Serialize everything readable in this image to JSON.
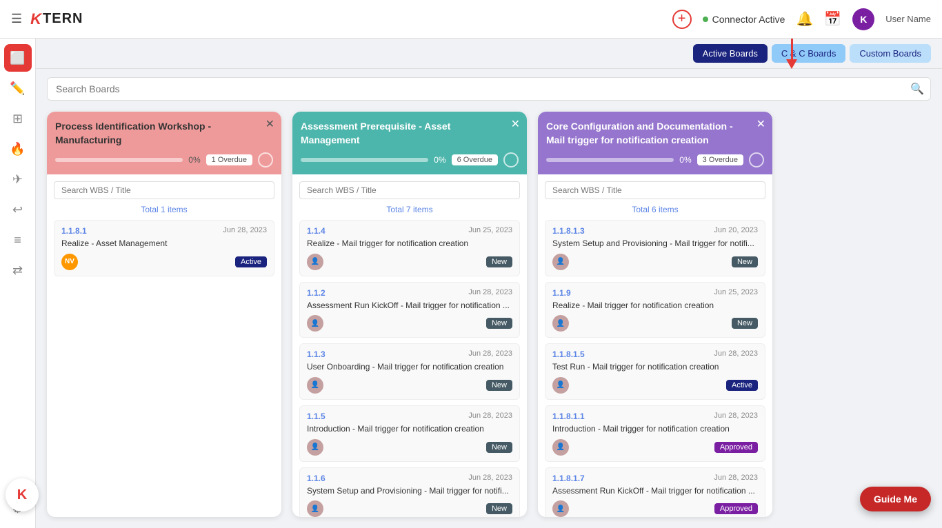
{
  "header": {
    "menu_icon": "☰",
    "logo_k": "K",
    "logo_text": "TERN",
    "connector_label": "Connector Active",
    "add_icon": "+",
    "notification_icon": "🔔",
    "calendar_icon": "📅",
    "avatar_letter": "K",
    "user_name": "User Name"
  },
  "toolbar": {
    "active_boards_label": "Active Boards",
    "cc_boards_label": "C & C Boards",
    "custom_boards_label": "Custom Boards"
  },
  "search": {
    "placeholder": "Search Boards"
  },
  "boards": [
    {
      "id": "board-1",
      "color": "pink",
      "title": "Process Identification Workshop - Manufacturing",
      "progress": 0,
      "progress_label": "0%",
      "overdue": "1 Overdue",
      "total_items": "Total 1 items",
      "search_placeholder": "Search WBS / Title",
      "tasks": [
        {
          "wbs": "1.1.8.1",
          "date": "Jun 28, 2023",
          "title": "Realize - Asset Management",
          "avatar_type": "nv",
          "avatar_text": "NV",
          "status": "Active",
          "status_class": "status-active"
        }
      ]
    },
    {
      "id": "board-2",
      "color": "teal",
      "title": "Assessment Prerequisite - Asset Management",
      "progress": 0,
      "progress_label": "0%",
      "overdue": "6 Overdue",
      "total_items": "Total 7 items",
      "search_placeholder": "Search WBS / Title",
      "tasks": [
        {
          "wbs": "1.1.4",
          "date": "Jun 25, 2023",
          "title": "Realize - Mail trigger for notification creation",
          "avatar_type": "img",
          "status": "New",
          "status_class": "status-new"
        },
        {
          "wbs": "1.1.2",
          "date": "Jun 28, 2023",
          "title": "Assessment Run KickOff - Mail trigger for notification ...",
          "avatar_type": "img",
          "status": "New",
          "status_class": "status-new"
        },
        {
          "wbs": "1.1.3",
          "date": "Jun 28, 2023",
          "title": "User Onboarding - Mail trigger for notification creation",
          "avatar_type": "img",
          "status": "New",
          "status_class": "status-new"
        },
        {
          "wbs": "1.1.5",
          "date": "Jun 28, 2023",
          "title": "Introduction - Mail trigger for notification creation",
          "avatar_type": "img",
          "status": "New",
          "status_class": "status-new"
        },
        {
          "wbs": "1.1.6",
          "date": "Jun 28, 2023",
          "title": "System Setup and Provisioning - Mail trigger for notifi...",
          "avatar_type": "img",
          "status": "New",
          "status_class": "status-new"
        }
      ]
    },
    {
      "id": "board-3",
      "color": "purple",
      "title": "Core Configuration and Documentation - Mail trigger for notification creation",
      "progress": 0,
      "progress_label": "0%",
      "overdue": "3 Overdue",
      "total_items": "Total 6 items",
      "search_placeholder": "Search WBS / Title",
      "tasks": [
        {
          "wbs": "1.1.8.1.3",
          "date": "Jun 20, 2023",
          "title": "System Setup and Provisioning - Mail trigger for notifi...",
          "avatar_type": "img",
          "status": "New",
          "status_class": "status-new"
        },
        {
          "wbs": "1.1.9",
          "date": "Jun 25, 2023",
          "title": "Realize - Mail trigger for notification creation",
          "avatar_type": "img",
          "status": "New",
          "status_class": "status-new"
        },
        {
          "wbs": "1.1.8.1.5",
          "date": "Jun 28, 2023",
          "title": "Test Run - Mail trigger for notification creation",
          "avatar_type": "img",
          "status": "Active",
          "status_class": "status-active"
        },
        {
          "wbs": "1.1.8.1.1",
          "date": "Jun 28, 2023",
          "title": "Introduction - Mail trigger for notification creation",
          "avatar_type": "img",
          "status": "Approved",
          "status_class": "status-approved"
        },
        {
          "wbs": "1.1.8.1.7",
          "date": "Jun 28, 2023",
          "title": "Assessment Run KickOff - Mail trigger for notification ...",
          "avatar_type": "img",
          "status": "Approved",
          "status_class": "status-approved"
        }
      ]
    }
  ],
  "guide_me_label": "Guide Me",
  "k_widget_label": "K",
  "sidebar_icons": [
    "☰",
    "✏️",
    "⊞",
    "🔥",
    "✉",
    "↩",
    "≡",
    "⇄",
    "⚙"
  ],
  "arrow": "↓"
}
